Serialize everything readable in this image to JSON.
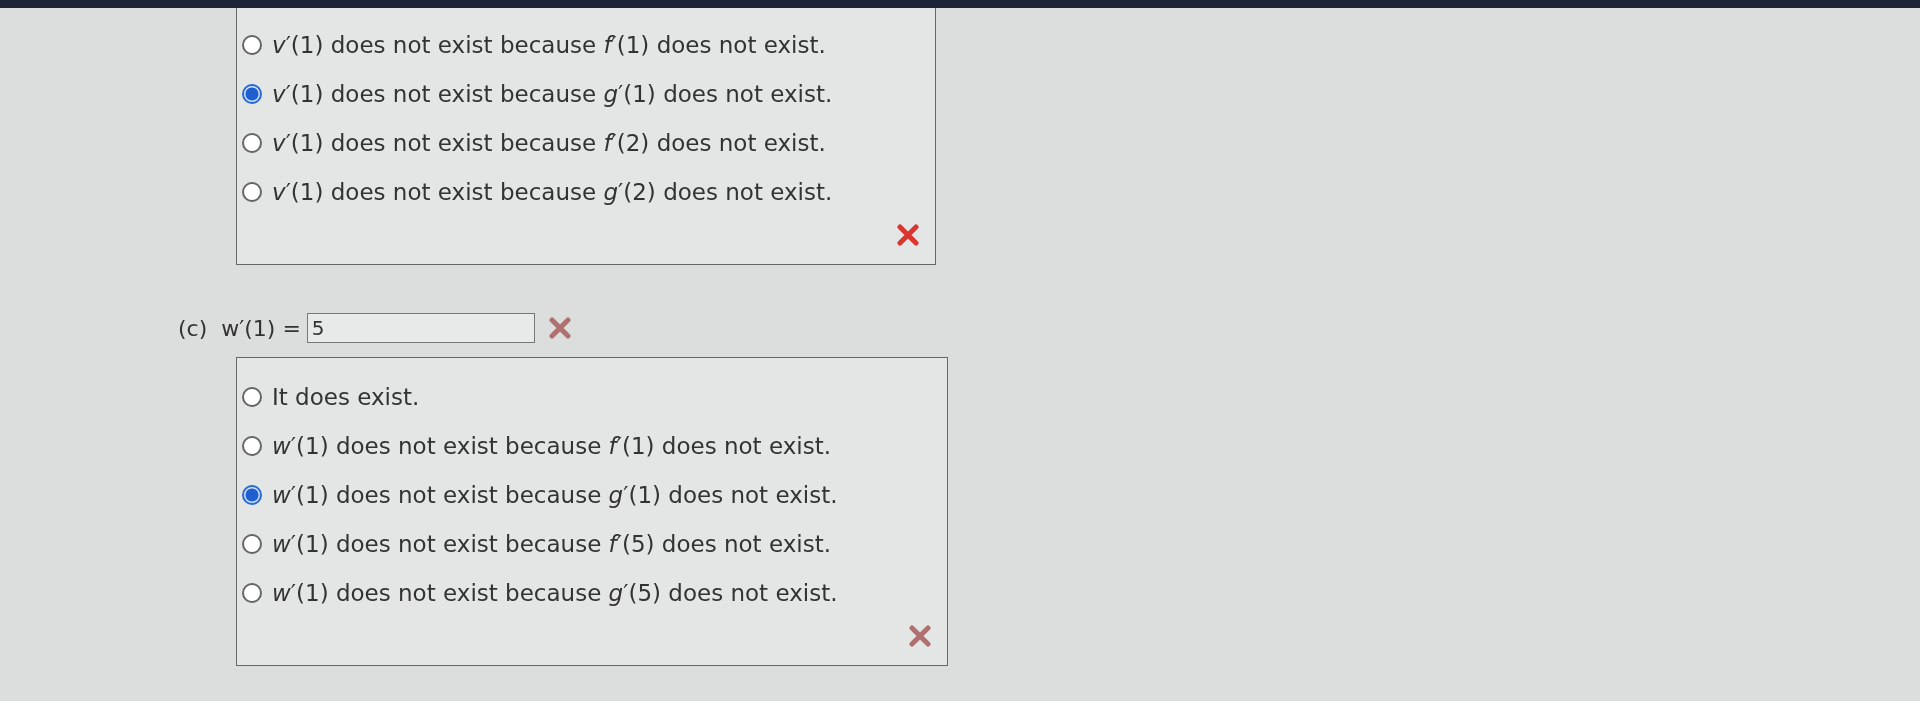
{
  "part_b": {
    "options": [
      {
        "text": "*v*′(1) does not exist because *f*′(1) does not exist.",
        "selected": false
      },
      {
        "text": "*v*′(1) does not exist because *g*′(1) does not exist.",
        "selected": true
      },
      {
        "text": "*v*′(1) does not exist because *f*′(2) does not exist.",
        "selected": false
      },
      {
        "text": "*v*′(1) does not exist because *g*′(2) does not exist.",
        "selected": false
      }
    ],
    "incorrect": true
  },
  "part_c": {
    "label": "(c)",
    "expression": "w′(1) =",
    "answer": {
      "value": "5"
    },
    "answer_incorrect": true,
    "options": [
      {
        "text": "It does exist.",
        "selected": false
      },
      {
        "text": "*w*′(1) does not exist because *f*′(1) does not exist.",
        "selected": false
      },
      {
        "text": "*w*′(1) does not exist because *g*′(1) does not exist.",
        "selected": true
      },
      {
        "text": "*w*′(1) does not exist because *f*′(5) does not exist.",
        "selected": false
      },
      {
        "text": "*w*′(1) does not exist because *g*′(5) does not exist.",
        "selected": false
      }
    ],
    "incorrect": true
  }
}
